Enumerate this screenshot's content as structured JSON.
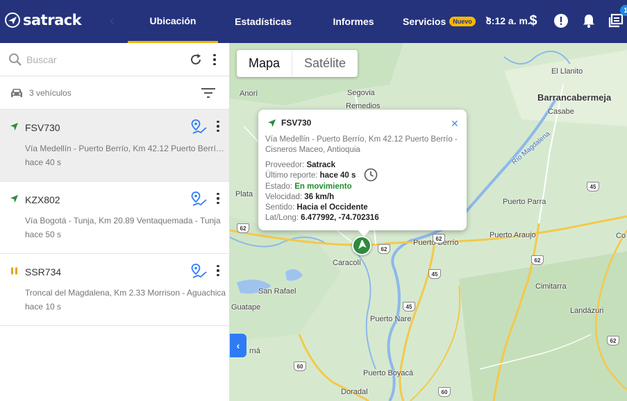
{
  "header": {
    "brand": "satrack",
    "tabs": [
      {
        "label": "Ubicación"
      },
      {
        "label": "Estadísticas"
      },
      {
        "label": "Informes"
      },
      {
        "label": "Servicios"
      }
    ],
    "new_badge": "Nuevo",
    "time": "3:12 a. m.",
    "notification_count": "1",
    "icons": [
      "dollar-icon",
      "alert-icon",
      "bell-icon",
      "inbox-icon"
    ]
  },
  "sidebar": {
    "search_placeholder": "Buscar",
    "vehicle_count": "3 vehículos",
    "vehicles": [
      {
        "plate": "FSV730",
        "address": "Vía Medellín - Puerto Berrío, Km 42.12 Puerto Berrío - Cisneros Maceo, Antioquia",
        "time": "hace 40 s",
        "status": "moving",
        "status_color": "#2e8b3d"
      },
      {
        "plate": "KZX802",
        "address": "Vía Bogotá - Tunja, Km 20.89 Ventaquemada - Tunja",
        "time": "hace 50 s",
        "status": "moving",
        "status_color": "#2e8b3d"
      },
      {
        "plate": "SSR734",
        "address": "Troncal del Magdalena, Km 2.33 Morrison - Aguachica",
        "time": "hace 10 s",
        "status": "paused",
        "status_color": "#e0a800"
      }
    ]
  },
  "map": {
    "types": [
      "Mapa",
      "Satélite"
    ],
    "labels": {
      "anori": "Anorí",
      "segovia": "Segovia",
      "remedios": "Remedios",
      "barranca": "Barrancabermeja",
      "casabe": "Casabe",
      "llanito": "El Llanito",
      "rio": "Río Magdalena",
      "puerto_parra": "Puerto Parra",
      "puerto_berrio": "Puerto Berrío",
      "puerto_araujo": "Puerto Araujo",
      "caracoli": "Caracolí",
      "cimitarra": "Cimitarra",
      "san_rafael": "San Rafael",
      "guatape": "Guatape",
      "puerto_nare": "Puerto Nare",
      "landazuri": "Landázuri",
      "puerto_boyaca": "Puerto Boyacá",
      "doradal": "Doradal",
      "plata": "Plata",
      "rna": "rná",
      "cos": "Co",
      "cos2": "Co"
    },
    "shields": [
      "62",
      "62",
      "62",
      "62",
      "45",
      "45",
      "45",
      "60",
      "60",
      "62"
    ]
  },
  "popup": {
    "plate": "FSV730",
    "address": "Vía Medellín - Puerto Berrío, Km 42.12 Puerto Berrío - Cisneros Maceo, Antioquia",
    "provider_label": "Proveedor:",
    "provider": "Satrack",
    "last_report_label": "Último reporte:",
    "last_report": "hace 40 s",
    "state_label": "Estado:",
    "state": "En movimiento",
    "speed_label": "Velocidad:",
    "speed": "36 km/h",
    "heading_label": "Sentido:",
    "heading": "Hacia el Occidente",
    "latlong_label": "Lat/Long:",
    "latlong": "6.477992, -74.702316",
    "state_color": "#1e8e2e"
  }
}
